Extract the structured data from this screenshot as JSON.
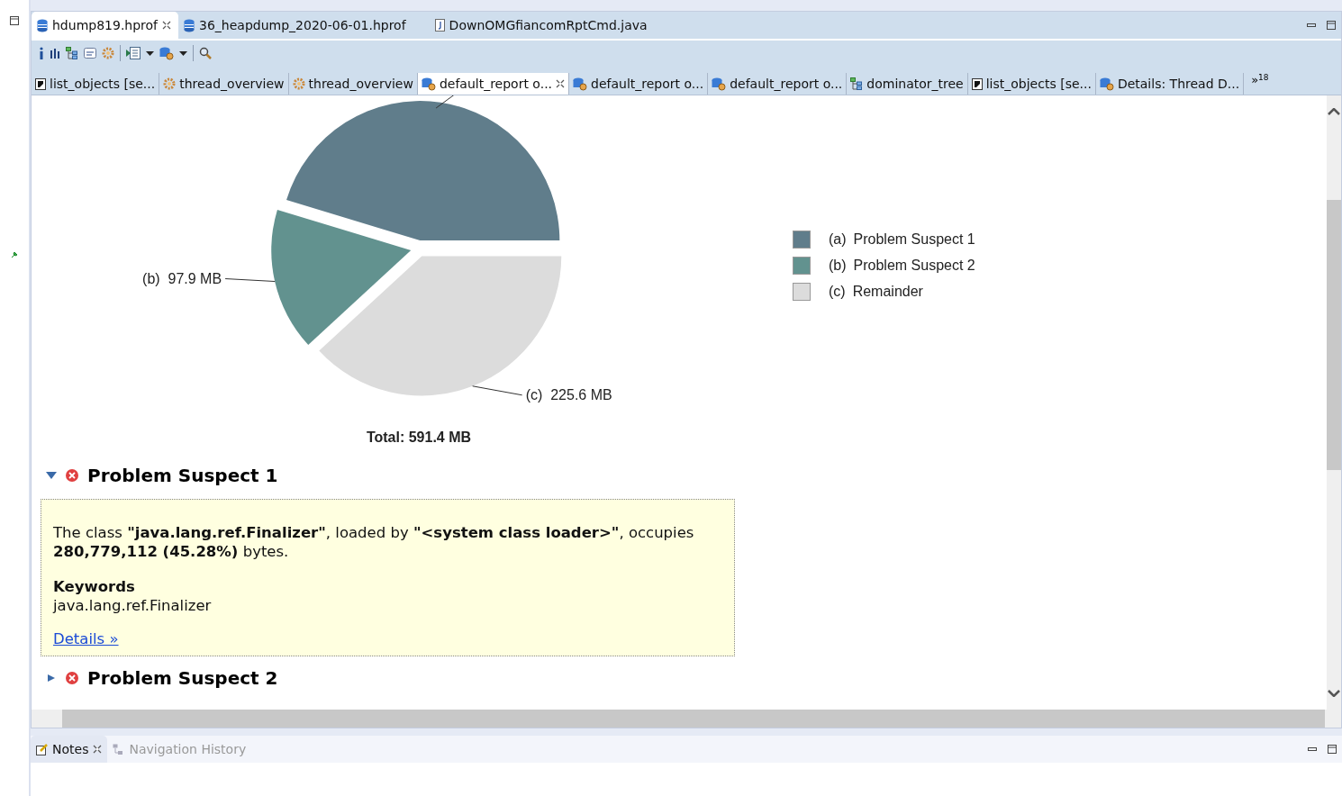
{
  "editor_tabs": [
    {
      "label": "hdump819.hprof",
      "kind": "heap",
      "selected": true,
      "closable": true
    },
    {
      "label": "36_heapdump_2020-06-01.hprof",
      "kind": "heap",
      "selected": false,
      "closable": false
    },
    {
      "label": "DownOMGfiancomRptCmd.java",
      "kind": "java",
      "selected": false,
      "closable": false
    }
  ],
  "report_tabs": [
    {
      "label": "list_objects  [se...",
      "kind": "list",
      "selected": false,
      "closable": false
    },
    {
      "label": "thread_overview",
      "kind": "gear",
      "selected": false,
      "closable": false
    },
    {
      "label": "thread_overview",
      "kind": "gear",
      "selected": false,
      "closable": false
    },
    {
      "label": "default_report  o...",
      "kind": "query",
      "selected": true,
      "closable": true
    },
    {
      "label": "default_report  o...",
      "kind": "query",
      "selected": false,
      "closable": false
    },
    {
      "label": "default_report  o...",
      "kind": "query",
      "selected": false,
      "closable": false
    },
    {
      "label": "dominator_tree",
      "kind": "tree",
      "selected": false,
      "closable": false
    },
    {
      "label": "list_objects  [se...",
      "kind": "list",
      "selected": false,
      "closable": false
    },
    {
      "label": "Details: Thread D...",
      "kind": "query",
      "selected": false,
      "closable": false
    }
  ],
  "overflow": {
    "chevron": "»",
    "count": "18"
  },
  "chart": {
    "chart_data": {
      "type": "pie",
      "values": [
        45.3,
        16.55,
        38.15
      ],
      "colors": [
        "#607d8b",
        "#62928f",
        "#dcdcdc"
      ]
    },
    "slice_labels": [
      {
        "marker": "(b)",
        "value": "97.9 MB"
      },
      {
        "marker": "(c)",
        "value": "225.6 MB"
      }
    ],
    "total": "Total: 591.4 MB",
    "legend": [
      {
        "marker": "(a)",
        "label": "Problem Suspect 1",
        "color": "#607d8b"
      },
      {
        "marker": "(b)",
        "label": "Problem Suspect 2",
        "color": "#62928f"
      },
      {
        "marker": "(c)",
        "label": "Remainder",
        "color": "#dcdcdc"
      }
    ]
  },
  "suspects": [
    {
      "title": "Problem Suspect 1",
      "expanded": true,
      "description": "The class **\"java.lang.ref.Finalizer\"**, loaded by **\"<system class loader>\"**, occupies **280,779,112 (45.28%)** bytes.",
      "keywords_title": "Keywords",
      "keywords": "java.lang.ref.Finalizer",
      "link": "Details »"
    },
    {
      "title": "Problem Suspect 2",
      "expanded": false
    }
  ],
  "bottom_tabs": [
    {
      "label": "Notes",
      "selected": true,
      "closable": true
    },
    {
      "label": "Navigation History",
      "selected": false,
      "closable": false
    }
  ]
}
